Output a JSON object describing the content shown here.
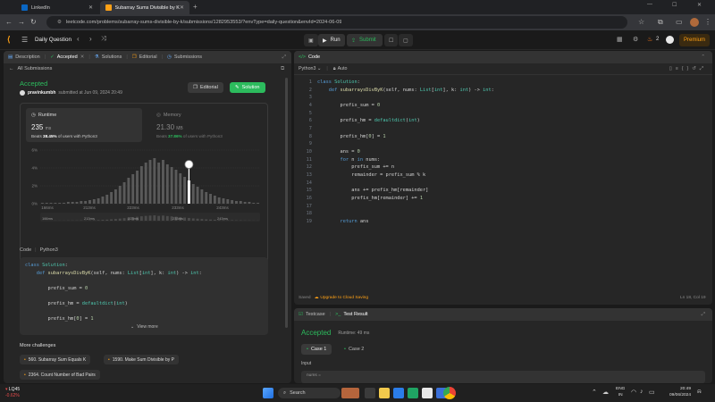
{
  "browser": {
    "tabs": [
      {
        "label": "LinkedIn"
      },
      {
        "label": "Subarray Sums Divisible by K -"
      }
    ],
    "url": "leetcode.com/problems/subarray-sums-divisible-by-k/submissions/1282953553/?envType=daily-question&envId=2024-06-09"
  },
  "header": {
    "title": "Daily Question",
    "run_label": "Run",
    "submit_label": "Submit",
    "streak": "2",
    "premium_label": "Premium"
  },
  "left": {
    "tabs": [
      "Description",
      "Accepted",
      "Solutions",
      "Editorial",
      "Submissions"
    ],
    "back_label": "All Submissions",
    "status": "Accepted",
    "user": "pravinkumbh",
    "submitted": "submitted at Jun 09, 2024 20:49",
    "editorial_btn": "Editorial",
    "solution_btn": "Solution",
    "runtime": {
      "label": "Runtime",
      "value": "235",
      "unit": "ms",
      "beats_prefix": "Beats",
      "beats_pct": "38.45%",
      "beats_suffix": "of users with Python3"
    },
    "memory": {
      "label": "Memory",
      "value": "21.30",
      "unit": "MB",
      "beats_prefix": "Beats",
      "beats_pct": "37.86%",
      "beats_suffix": "of users with Python3"
    },
    "chart_yticks": [
      "6%",
      "4%",
      "2%",
      "0%"
    ],
    "chart_xticks": [
      "166ms",
      "213ms",
      "223ms",
      "233ms",
      "243ms"
    ],
    "code_label": "Code",
    "code_lang": "Python3",
    "code_lines": [
      "class Solution:",
      "    def subarraysDivByK(self, nums: List[int], k: int) -> int:",
      "",
      "        prefix_sum = 0",
      "",
      "        prefix_hm = defaultdict(int)",
      "",
      "        prefix_hm[0] = 1"
    ],
    "view_more": "View more",
    "more_title": "More challenges",
    "challenges": [
      "560. Subarray Sum Equals K",
      "1590. Make Sum Divisible by P",
      "2364. Count Number of Bad Pairs"
    ]
  },
  "editor": {
    "title": "Code",
    "lang": "Python3",
    "mode": "Auto",
    "lines": [
      "class Solution:",
      "    def subarraysDivByK(self, nums: List[int], k: int) -> int:",
      "",
      "        prefix_sum = 0",
      "",
      "        prefix_hm = defaultdict(int)",
      "",
      "        prefix_hm[0] = 1",
      "",
      "        ans = 0",
      "        for n in nums:",
      "            prefix_sum += n",
      "            remainder = prefix_sum % k",
      "",
      "            ans += prefix_hm[remainder]",
      "            prefix_hm[remainder] += 1",
      "",
      "",
      "        return ans"
    ],
    "saved": "Saved",
    "upgrade": "Upgrade to Cloud Saving",
    "cursor": "Ln 18, Col 19"
  },
  "result": {
    "tab_testcase": "Testcase",
    "tab_result": "Test Result",
    "status": "Accepted",
    "runtime": "Runtime: 49 ms",
    "case1": "Case 1",
    "case2": "Case 2",
    "input_label": "Input",
    "input_value": "nums ="
  },
  "taskbar": {
    "stock_name": "LQ45",
    "stock_change": "-0.62%",
    "search_placeholder": "Search",
    "lang1": "ENG",
    "lang2": "IN",
    "time": "20:49",
    "date": "09/06/2024"
  },
  "colors": {
    "accent_green": "#2cbb5d",
    "accent_orange": "#ffa116",
    "link_blue": "#2e7cf6"
  },
  "chart_data": {
    "type": "bar",
    "x": [
      166,
      213,
      223,
      233,
      243
    ],
    "highlight": 235,
    "ylim": [
      0,
      6
    ],
    "values": [
      0.1,
      0.1,
      0.1,
      0.1,
      0.1,
      0.1,
      0.2,
      0.2,
      0.2,
      0.3,
      0.3,
      0.4,
      0.5,
      0.6,
      0.8,
      1.0,
      1.3,
      1.6,
      2.0,
      2.4,
      2.9,
      3.3,
      3.7,
      4.2,
      4.6,
      4.9,
      5.1,
      4.6,
      4.9,
      4.4,
      4.1,
      3.8,
      3.4,
      3.0,
      2.6,
      2.2,
      1.9,
      1.6,
      1.3,
      1.1,
      0.9,
      0.7,
      0.6,
      0.5,
      0.4,
      0.3,
      0.3,
      0.2,
      0.2,
      0.1,
      0.1
    ],
    "xlabel": "",
    "ylabel": ""
  }
}
